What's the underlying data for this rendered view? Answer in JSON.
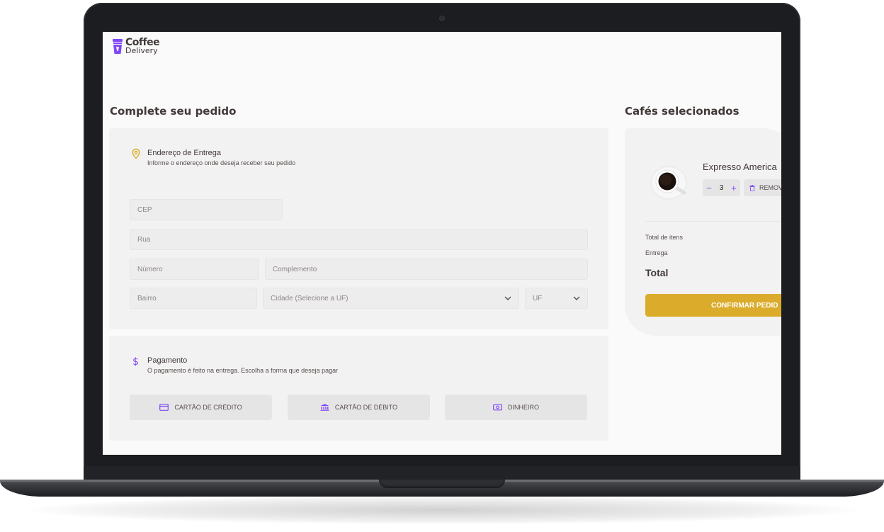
{
  "brand": {
    "line1": "Coffee",
    "line2": "Delivery",
    "accent_purple": "#8047f8",
    "accent_yellow": "#dbac2c"
  },
  "checkout": {
    "title": "Complete seu pedido",
    "address": {
      "title": "Endereço de Entrega",
      "subtitle": "Informe o endereço onde deseja receber seu pedido",
      "icon": "map-pin-icon",
      "fields": {
        "cep": "CEP",
        "rua": "Rua",
        "numero": "Número",
        "complemento": "Complemento",
        "bairro": "Bairro",
        "cidade": "Cidade (Selecione a UF)",
        "uf": "UF"
      }
    },
    "payment": {
      "title": "Pagamento",
      "subtitle": "O pagamento é feito na entrega. Escolha a forma que deseja pagar",
      "icon": "dollar-icon",
      "options": [
        {
          "label": "CARTÃO DE CRÉDITO",
          "icon": "credit-card-icon"
        },
        {
          "label": "CARTÃO DE DÉBITO",
          "icon": "bank-icon"
        },
        {
          "label": "DINHEIRO",
          "icon": "money-icon"
        }
      ]
    }
  },
  "cart": {
    "title": "Cafés selecionados",
    "items": [
      {
        "name": "Expresso America",
        "quantity": "3",
        "remove_label": "REMOV",
        "image": "coffee-cup-image"
      }
    ],
    "totals": {
      "items_label": "Total de itens",
      "delivery_label": "Entrega",
      "total_label": "Total"
    },
    "confirm_label": "CONFIRMAR PEDID"
  }
}
